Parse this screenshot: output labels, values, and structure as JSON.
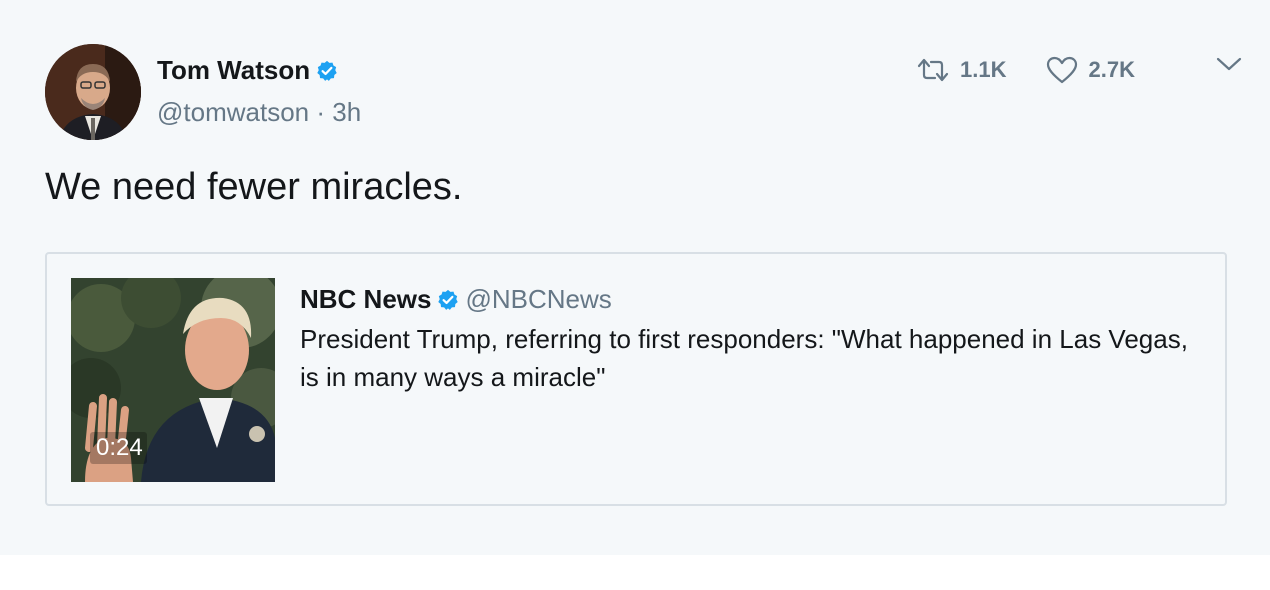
{
  "tweet": {
    "author_name": "Tom Watson",
    "handle": "@tomwatson",
    "separator": " · ",
    "time": "3h",
    "text": "We need fewer miracles.",
    "retweet_count": "1.1K",
    "like_count": "2.7K"
  },
  "quoted_tweet": {
    "author_name": "NBC News",
    "handle": "@NBCNews",
    "text": "President Trump, referring to first responders: \"What happened in Las Vegas, is in many ways a miracle\"",
    "video_duration": "0:24"
  },
  "icons": {
    "verified": "verified-badge-icon",
    "retweet": "retweet-icon",
    "like": "heart-icon",
    "menu": "chevron-down-icon"
  },
  "colors": {
    "background": "#f5f8fa",
    "verified_blue": "#1da1f2",
    "secondary_text": "#657786",
    "primary_text": "#14171a",
    "border": "#d8dfe5"
  }
}
